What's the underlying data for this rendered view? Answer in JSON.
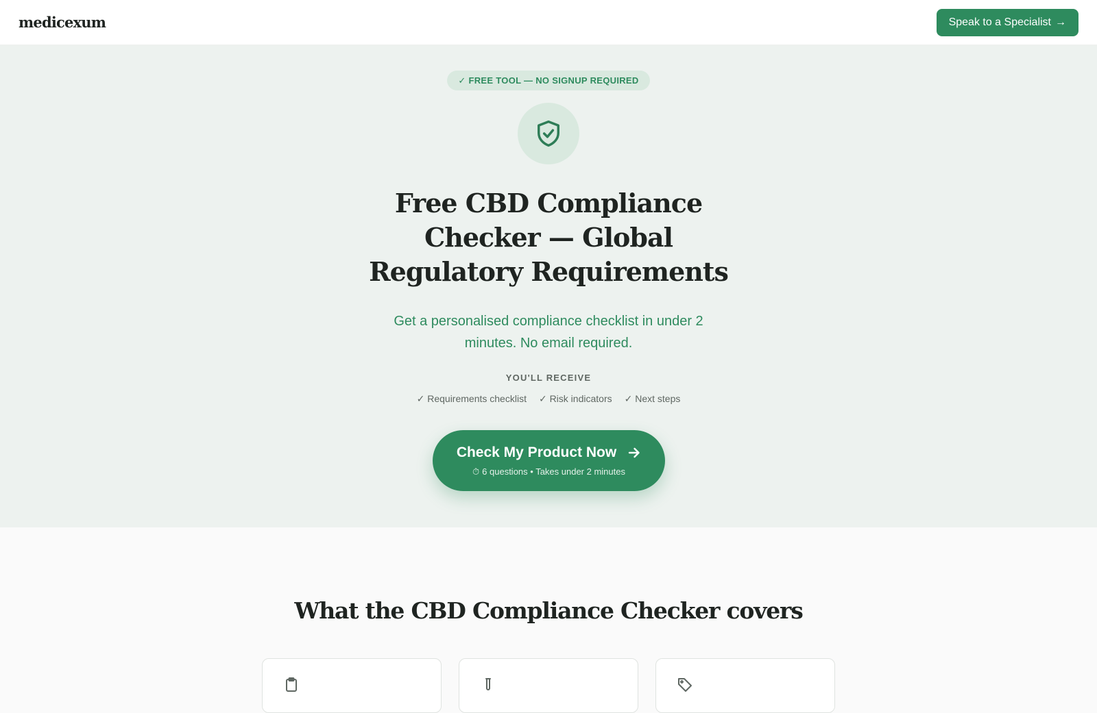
{
  "header": {
    "logo": "medicexum",
    "cta_label": "Speak to a Specialist",
    "cta_arrow": "→"
  },
  "hero": {
    "badge": "✓ FREE TOOL — NO SIGNUP REQUIRED",
    "shield_icon": "shield-check-icon",
    "title": "Free CBD Compliance Checker — Global Regulatory Requirements",
    "subtitle": "Get a personalised compliance checklist in under 2 minutes. No email required.",
    "receive_label": "YOU'LL RECEIVE",
    "receive_items": [
      "✓ Requirements checklist",
      "✓ Risk indicators",
      "✓ Next steps"
    ],
    "cta": {
      "label": "Check My Product Now",
      "meta": "6 questions • Takes under 2 minutes",
      "timer_icon": "⏱"
    }
  },
  "covers": {
    "title": "What the CBD Compliance Checker covers",
    "cards": [
      {
        "icon": "clipboard-icon"
      },
      {
        "icon": "test-tube-icon"
      },
      {
        "icon": "tag-icon"
      }
    ]
  },
  "colors": {
    "accent": "#2e8b5e",
    "hero_bg": "#edf2ef",
    "badge_bg": "#d9e9df",
    "text": "#1f2421"
  }
}
